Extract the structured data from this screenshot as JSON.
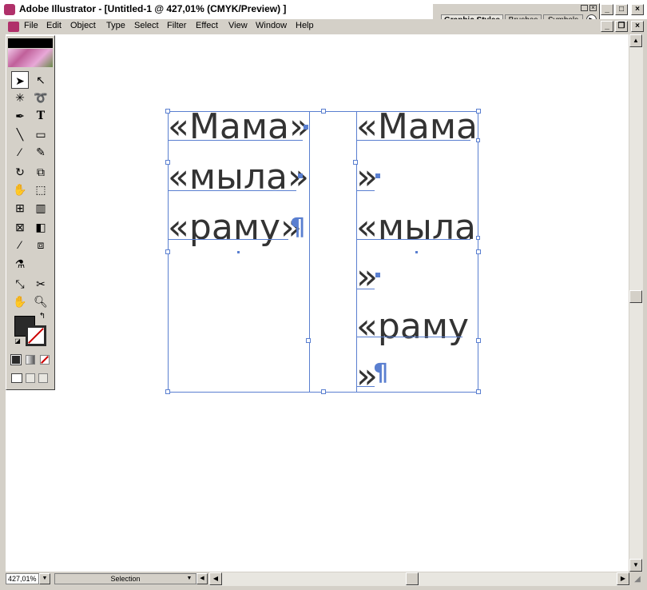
{
  "window": {
    "title": "Adobe Illustrator - [Untitled-1 @ 427,01% (CMYK/Preview) ]"
  },
  "menu": [
    "File",
    "Edit",
    "Object",
    "Type",
    "Select",
    "Filter",
    "Effect",
    "View",
    "Window",
    "Help"
  ],
  "panel": {
    "tabs": [
      "Graphic Styles",
      "Brushes",
      "Symbols"
    ],
    "active_tab": "Graphic Styles"
  },
  "status": {
    "zoom": "427,01%",
    "tool_status": "Selection"
  },
  "frame_left": {
    "lines": [
      "«Мама»",
      "«мыла»",
      "«раму»"
    ]
  },
  "frame_right": {
    "lines": [
      "«Мама",
      "»",
      "«мыла",
      "»",
      "«раму",
      "»"
    ]
  },
  "colors": {
    "selection": "#5a7fd0",
    "text": "#333333",
    "fill_swatch": "#2a2a2a"
  },
  "icons": {
    "tools": [
      "selection-arrow",
      "direct-selection",
      "magic-wand",
      "lasso",
      "pen",
      "type",
      "line-segment",
      "rectangle",
      "paintbrush",
      "pencil",
      "rotate",
      "scale",
      "warp",
      "free-transform",
      "symbol-sprayer",
      "column-graph",
      "mesh",
      "gradient",
      "eyedropper",
      "blend",
      "live-paint-bucket",
      "slice",
      "scissors",
      "hand",
      "zoom"
    ]
  }
}
